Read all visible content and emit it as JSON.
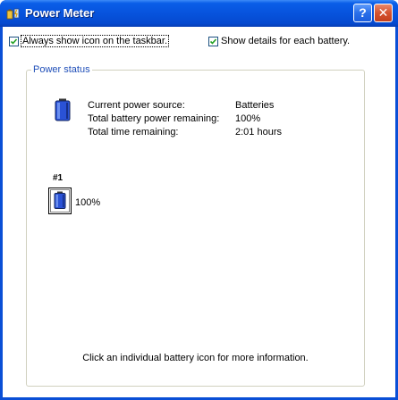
{
  "window": {
    "title": "Power Meter",
    "help_glyph": "?",
    "close_glyph": "✕"
  },
  "options": {
    "always_show_icon": {
      "label": "Always show icon on the taskbar.",
      "checked": true
    },
    "show_details": {
      "label": "Show details for each battery.",
      "checked": true
    }
  },
  "power_status": {
    "legend": "Power status",
    "rows": [
      {
        "label": "Current power source:",
        "value": "Batteries"
      },
      {
        "label": "Total battery power remaining:",
        "value": "100%"
      },
      {
        "label": "Total time remaining:",
        "value": "2:01 hours"
      }
    ]
  },
  "batteries": [
    {
      "label": "#1",
      "percent_text": "100%",
      "charge_fraction": 1.0
    }
  ],
  "hint": "Click an individual battery icon for more information.",
  "icons": {
    "title": "power-meter-icon",
    "status": "battery-icon",
    "battery_detail": "battery-icon"
  },
  "colors": {
    "titlebar": "#0753dd",
    "legend_text": "#1f4eb8",
    "battery_blue": "#2a52d6"
  }
}
